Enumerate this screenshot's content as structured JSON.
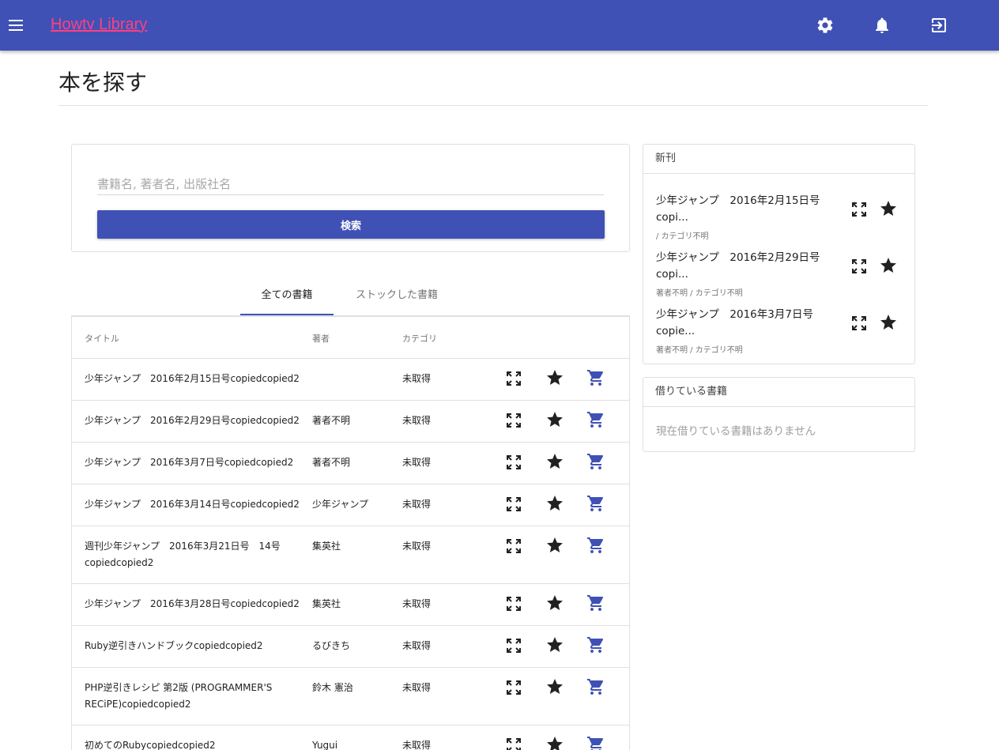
{
  "app": {
    "title": "Howtv Library"
  },
  "icons": {
    "menu": "menu-icon",
    "settings": "gear-icon",
    "notifications": "bell-icon",
    "logout": "exit-icon",
    "expand": "fullscreen-icon",
    "star": "star-icon",
    "cart": "cart-icon"
  },
  "colors": {
    "primary": "#3f51b5",
    "accent": "#ff4081"
  },
  "page": {
    "title": "本を探す"
  },
  "search": {
    "placeholder": "書籍名, 著者名, 出版社名",
    "value": "",
    "button_label": "検索"
  },
  "tabs": [
    {
      "label": "全ての書籍",
      "active": true
    },
    {
      "label": "ストックした書籍",
      "active": false
    }
  ],
  "table": {
    "headers": {
      "title": "タイトル",
      "author": "著者",
      "category": "カテゴリ"
    },
    "rows": [
      {
        "title": "少年ジャンプ　2016年2月15日号copiedcopied2",
        "author": "",
        "category": "未取得"
      },
      {
        "title": "少年ジャンプ　2016年2月29日号copiedcopied2",
        "author": "著者不明",
        "category": "未取得"
      },
      {
        "title": "少年ジャンプ　2016年3月7日号copiedcopied2",
        "author": "著者不明",
        "category": "未取得"
      },
      {
        "title": "少年ジャンプ　2016年3月14日号copiedcopied2",
        "author": "少年ジャンプ",
        "category": "未取得"
      },
      {
        "title": "週刊少年ジャンプ　2016年3月21日号　14号copiedcopied2",
        "author": "集英社",
        "category": "未取得"
      },
      {
        "title": "少年ジャンプ　2016年3月28日号copiedcopied2",
        "author": "集英社",
        "category": "未取得"
      },
      {
        "title": "Ruby逆引きハンドブックcopiedcopied2",
        "author": "るびきち",
        "category": "未取得"
      },
      {
        "title": "PHP逆引きレシピ 第2版 (PROGRAMMER'S RECiPE)copiedcopied2",
        "author": "鈴木 憲治",
        "category": "未取得"
      },
      {
        "title": "初めてのRubycopiedcopied2",
        "author": "Yugui",
        "category": "未取得"
      }
    ]
  },
  "new_books": {
    "heading": "新刊",
    "items": [
      {
        "title": "少年ジャンプ　2016年2月15日号 copi...",
        "meta": "/ カテゴリ不明"
      },
      {
        "title": "少年ジャンプ　2016年2月29日号 copi...",
        "meta": "著者不明 / カテゴリ不明"
      },
      {
        "title": "少年ジャンプ　2016年3月7日号 copie...",
        "meta": "著者不明 / カテゴリ不明"
      }
    ]
  },
  "borrowed": {
    "heading": "借りている書籍",
    "empty_text": "現在借りている書籍はありません"
  }
}
